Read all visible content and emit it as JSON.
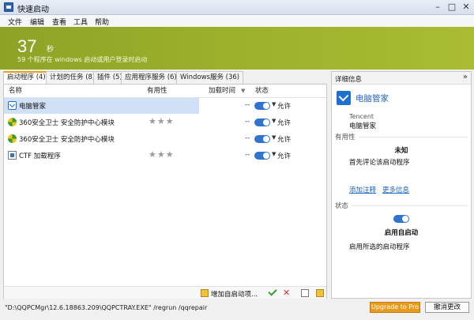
{
  "window": {
    "title": "快速启动",
    "min": "–",
    "max": "□",
    "close": "✕"
  },
  "menu": [
    "文件",
    "编辑",
    "查看",
    "工具",
    "帮助"
  ],
  "banner": {
    "time": "37",
    "unit": "秒",
    "description": "59 个程序在 windows 启动或用户登录时启动",
    "color": "#9fb22d"
  },
  "tabs": [
    "启动程序 (4)",
    "计划的任务 (8)",
    "插件 (5)",
    "应用程序服务 (6)",
    "Windows服务 (36)"
  ],
  "columns": {
    "name": "名称",
    "usefulness": "有用性",
    "load_time": "加载时间",
    "sort": "▼",
    "status": "状态"
  },
  "rows": [
    {
      "name": "电脑管家",
      "icon": "qq-shield-icon",
      "stars": "",
      "time": "--",
      "status": "允许",
      "selected": true
    },
    {
      "name": "360安全卫士 安全防护中心模块",
      "icon": "360-icon",
      "stars": "★★★",
      "time": "--",
      "status": "允许",
      "selected": false
    },
    {
      "name": "360安全卫士 安全防护中心模块",
      "icon": "360-icon",
      "stars": "",
      "time": "--",
      "status": "允许",
      "selected": false
    },
    {
      "name": "CTF 加载程序",
      "icon": "ctf-icon",
      "stars": "★★★",
      "time": "--",
      "status": "允许",
      "selected": false
    }
  ],
  "toolbar": {
    "add_label": "增加自启动项..."
  },
  "details": {
    "title": "详细信息",
    "collapse": "»",
    "app_name": "电脑管家",
    "vendor": "Tencent",
    "product": "电脑管家",
    "usefulness_section": "有用性",
    "usefulness_value": "未知",
    "usefulness_hint": "首先评论该启动程序",
    "add_comment": "添加注释",
    "more_info": "更多信息",
    "status_section": "状态",
    "status_value": "启用自启动",
    "status_hint": "启用所选的启动程序"
  },
  "status_bar": {
    "command": "\"D:\\QQPCMgr\\12.6.18863.209\\QQPCTRAY.EXE\" /regrun /qqrepair",
    "upgrade": "Upgrade to Pro",
    "cancel": "撤消更改"
  }
}
